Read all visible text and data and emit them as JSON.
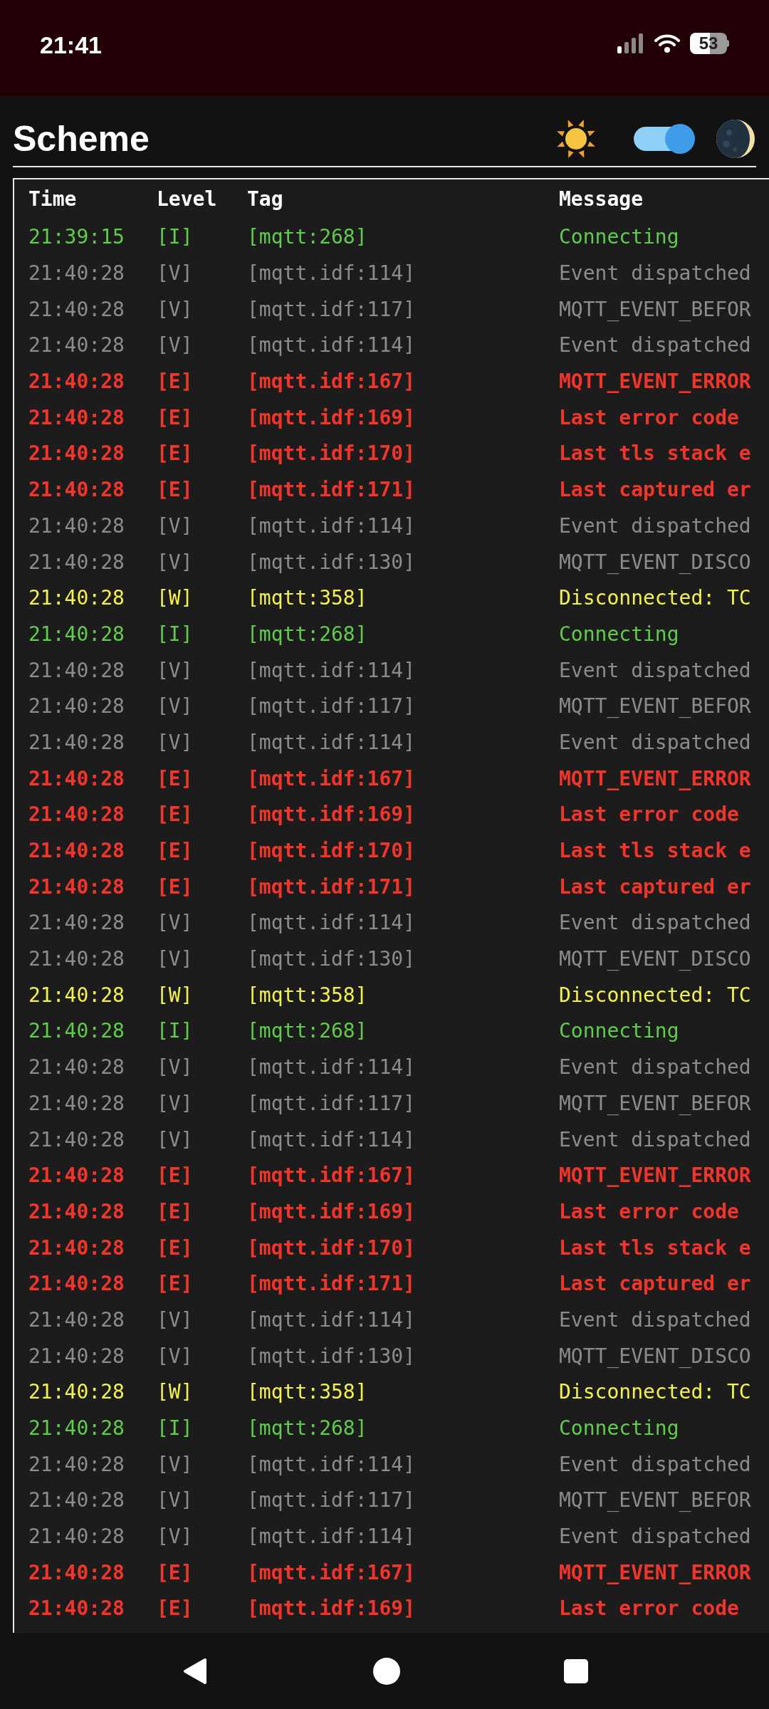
{
  "status_bar": {
    "time": "21:41",
    "battery": "53"
  },
  "header": {
    "title": "Scheme",
    "theme_toggle": {
      "on": true
    }
  },
  "table": {
    "columns": [
      "Time",
      "Level",
      "Tag",
      "Message"
    ],
    "rows": [
      {
        "kind": "info",
        "time": "21:39:15",
        "level_text": "[I]",
        "tag": "[mqtt:268]",
        "message": "Connecting"
      },
      {
        "kind": "verbose",
        "time": "21:40:28",
        "level_text": "[V]",
        "tag": "[mqtt.idf:114]",
        "message": "Event dispatched"
      },
      {
        "kind": "verbose",
        "time": "21:40:28",
        "level_text": "[V]",
        "tag": "[mqtt.idf:117]",
        "message": "MQTT_EVENT_BEFOR"
      },
      {
        "kind": "verbose",
        "time": "21:40:28",
        "level_text": "[V]",
        "tag": "[mqtt.idf:114]",
        "message": "Event dispatched"
      },
      {
        "kind": "error",
        "time": "21:40:28",
        "level_text": "[E]",
        "tag": "[mqtt.idf:167]",
        "message": "MQTT_EVENT_ERROR"
      },
      {
        "kind": "error",
        "time": "21:40:28",
        "level_text": "[E]",
        "tag": "[mqtt.idf:169]",
        "message": "Last error code"
      },
      {
        "kind": "error",
        "time": "21:40:28",
        "level_text": "[E]",
        "tag": "[mqtt.idf:170]",
        "message": "Last tls stack e"
      },
      {
        "kind": "error",
        "time": "21:40:28",
        "level_text": "[E]",
        "tag": "[mqtt.idf:171]",
        "message": "Last captured er"
      },
      {
        "kind": "verbose",
        "time": "21:40:28",
        "level_text": "[V]",
        "tag": "[mqtt.idf:114]",
        "message": "Event dispatched"
      },
      {
        "kind": "verbose",
        "time": "21:40:28",
        "level_text": "[V]",
        "tag": "[mqtt.idf:130]",
        "message": "MQTT_EVENT_DISCO"
      },
      {
        "kind": "warning",
        "time": "21:40:28",
        "level_text": "[W]",
        "tag": "[mqtt:358]",
        "message": "Disconnected: TC"
      },
      {
        "kind": "info",
        "time": "21:40:28",
        "level_text": "[I]",
        "tag": "[mqtt:268]",
        "message": "Connecting"
      },
      {
        "kind": "verbose",
        "time": "21:40:28",
        "level_text": "[V]",
        "tag": "[mqtt.idf:114]",
        "message": "Event dispatched"
      },
      {
        "kind": "verbose",
        "time": "21:40:28",
        "level_text": "[V]",
        "tag": "[mqtt.idf:117]",
        "message": "MQTT_EVENT_BEFOR"
      },
      {
        "kind": "verbose",
        "time": "21:40:28",
        "level_text": "[V]",
        "tag": "[mqtt.idf:114]",
        "message": "Event dispatched"
      },
      {
        "kind": "error",
        "time": "21:40:28",
        "level_text": "[E]",
        "tag": "[mqtt.idf:167]",
        "message": "MQTT_EVENT_ERROR"
      },
      {
        "kind": "error",
        "time": "21:40:28",
        "level_text": "[E]",
        "tag": "[mqtt.idf:169]",
        "message": "Last error code"
      },
      {
        "kind": "error",
        "time": "21:40:28",
        "level_text": "[E]",
        "tag": "[mqtt.idf:170]",
        "message": "Last tls stack e"
      },
      {
        "kind": "error",
        "time": "21:40:28",
        "level_text": "[E]",
        "tag": "[mqtt.idf:171]",
        "message": "Last captured er"
      },
      {
        "kind": "verbose",
        "time": "21:40:28",
        "level_text": "[V]",
        "tag": "[mqtt.idf:114]",
        "message": "Event dispatched"
      },
      {
        "kind": "verbose",
        "time": "21:40:28",
        "level_text": "[V]",
        "tag": "[mqtt.idf:130]",
        "message": "MQTT_EVENT_DISCO"
      },
      {
        "kind": "warning",
        "time": "21:40:28",
        "level_text": "[W]",
        "tag": "[mqtt:358]",
        "message": "Disconnected: TC"
      },
      {
        "kind": "info",
        "time": "21:40:28",
        "level_text": "[I]",
        "tag": "[mqtt:268]",
        "message": "Connecting"
      },
      {
        "kind": "verbose",
        "time": "21:40:28",
        "level_text": "[V]",
        "tag": "[mqtt.idf:114]",
        "message": "Event dispatched"
      },
      {
        "kind": "verbose",
        "time": "21:40:28",
        "level_text": "[V]",
        "tag": "[mqtt.idf:117]",
        "message": "MQTT_EVENT_BEFOR"
      },
      {
        "kind": "verbose",
        "time": "21:40:28",
        "level_text": "[V]",
        "tag": "[mqtt.idf:114]",
        "message": "Event dispatched"
      },
      {
        "kind": "error",
        "time": "21:40:28",
        "level_text": "[E]",
        "tag": "[mqtt.idf:167]",
        "message": "MQTT_EVENT_ERROR"
      },
      {
        "kind": "error",
        "time": "21:40:28",
        "level_text": "[E]",
        "tag": "[mqtt.idf:169]",
        "message": "Last error code"
      },
      {
        "kind": "error",
        "time": "21:40:28",
        "level_text": "[E]",
        "tag": "[mqtt.idf:170]",
        "message": "Last tls stack e"
      },
      {
        "kind": "error",
        "time": "21:40:28",
        "level_text": "[E]",
        "tag": "[mqtt.idf:171]",
        "message": "Last captured er"
      },
      {
        "kind": "verbose",
        "time": "21:40:28",
        "level_text": "[V]",
        "tag": "[mqtt.idf:114]",
        "message": "Event dispatched"
      },
      {
        "kind": "verbose",
        "time": "21:40:28",
        "level_text": "[V]",
        "tag": "[mqtt.idf:130]",
        "message": "MQTT_EVENT_DISCO"
      },
      {
        "kind": "warning",
        "time": "21:40:28",
        "level_text": "[W]",
        "tag": "[mqtt:358]",
        "message": "Disconnected: TC"
      },
      {
        "kind": "info",
        "time": "21:40:28",
        "level_text": "[I]",
        "tag": "[mqtt:268]",
        "message": "Connecting"
      },
      {
        "kind": "verbose",
        "time": "21:40:28",
        "level_text": "[V]",
        "tag": "[mqtt.idf:114]",
        "message": "Event dispatched"
      },
      {
        "kind": "verbose",
        "time": "21:40:28",
        "level_text": "[V]",
        "tag": "[mqtt.idf:117]",
        "message": "MQTT_EVENT_BEFOR"
      },
      {
        "kind": "verbose",
        "time": "21:40:28",
        "level_text": "[V]",
        "tag": "[mqtt.idf:114]",
        "message": "Event dispatched"
      },
      {
        "kind": "error",
        "time": "21:40:28",
        "level_text": "[E]",
        "tag": "[mqtt.idf:167]",
        "message": "MQTT_EVENT_ERROR"
      },
      {
        "kind": "error",
        "time": "21:40:28",
        "level_text": "[E]",
        "tag": "[mqtt.idf:169]",
        "message": "Last error code"
      }
    ]
  }
}
